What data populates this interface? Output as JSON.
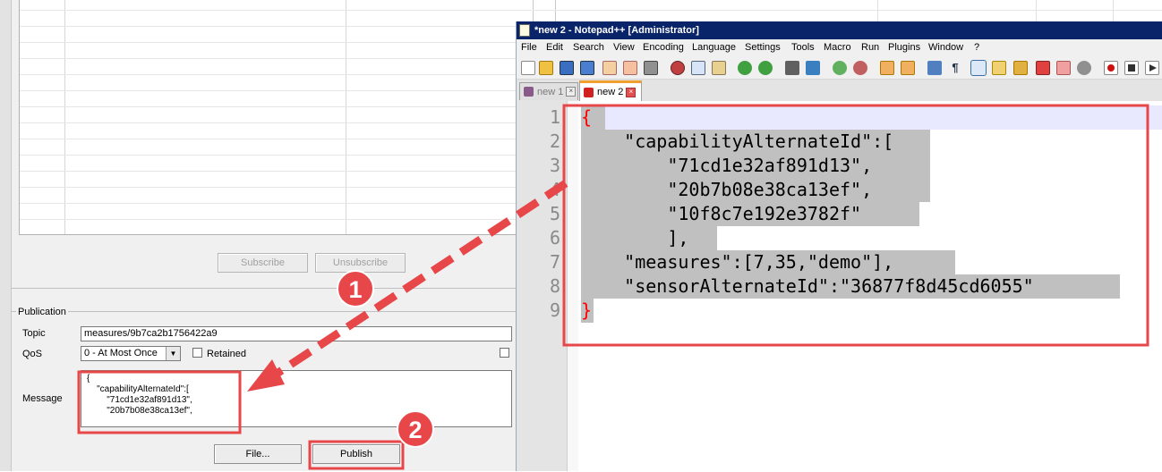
{
  "mqtt_client": {
    "subscription": {
      "subscribe_label": "Subscribe",
      "unsubscribe_label": "Unsubscribe"
    },
    "publication": {
      "group_label": "Publication",
      "topic_label": "Topic",
      "topic_value": "measures/9b7ca2b1756422a9",
      "qos_label": "QoS",
      "qos_selected": "0 - At Most Once",
      "retained_label": "Retained",
      "retained_checked": false,
      "message_label": "Message",
      "message_value": "{\n    \"capabilityAlternateId\":[\n        \"71cd1e32af891d13\",\n        \"20b7b08e38ca13ef\",",
      "file_button_label": "File...",
      "publish_button_label": "Publish"
    }
  },
  "notepad": {
    "window_title": "*new 2 - Notepad++ [Administrator]",
    "menu": [
      "File",
      "Edit",
      "Search",
      "View",
      "Encoding",
      "Language",
      "Settings",
      "Tools",
      "Macro",
      "Run",
      "Plugins",
      "Window",
      "?"
    ],
    "tabs": [
      {
        "label": "new 1",
        "active": false
      },
      {
        "label": "new 2",
        "active": true
      }
    ],
    "line_numbers": [
      "1",
      "2",
      "3",
      "4",
      "5",
      "6",
      "7",
      "8",
      "9"
    ],
    "code_lines": [
      "{",
      "    \"capabilityAlternateId\":[",
      "        \"71cd1e32af891d13\",",
      "        \"20b7b08e38ca13ef\",",
      "        \"10f8c7e192e3782f\"",
      "        ],",
      "    \"measures\":[7,35,\"demo\"],",
      "    \"sensorAlternateId\":\"36877f8d45cd6055\"",
      "}"
    ]
  },
  "annotations": {
    "step1": "1",
    "step2": "2",
    "highlight_color": "#e8474a"
  },
  "icons": [
    "notepad-app-icon",
    "save-disk-icon",
    "close-tab-icon",
    "dropdown-arrow-icon"
  ]
}
